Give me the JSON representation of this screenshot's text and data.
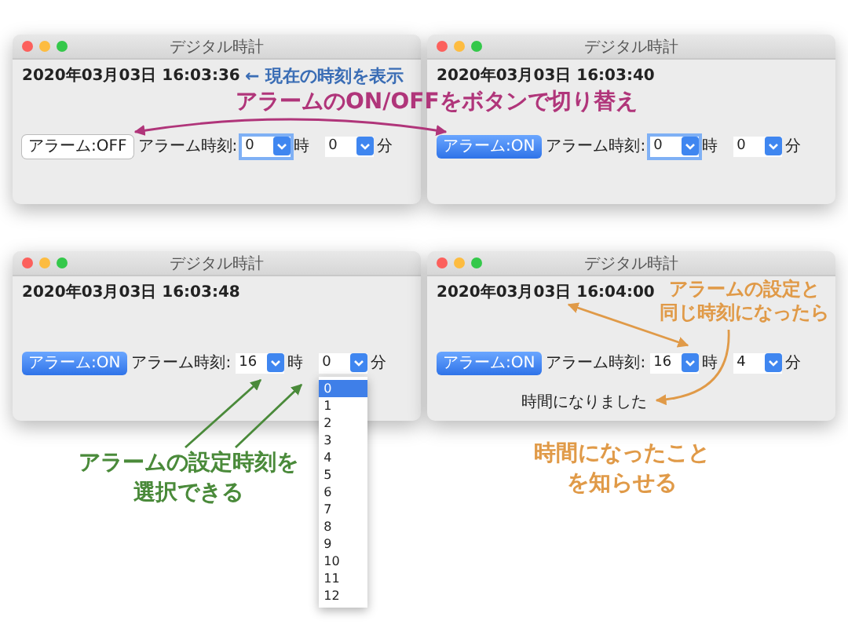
{
  "windows": [
    {
      "title": "デジタル時計",
      "datetime": "2020年03月03日 16:03:36",
      "alarm_button": {
        "label": "アラーム:OFF",
        "on": false
      },
      "time_label": "アラーム時刻:",
      "hour": {
        "value": "0",
        "focused": true
      },
      "hour_unit": "時",
      "minute": {
        "value": "0",
        "focused": false
      },
      "minute_unit": "分"
    },
    {
      "title": "デジタル時計",
      "datetime": "2020年03月03日 16:03:40",
      "alarm_button": {
        "label": "アラーム:ON",
        "on": true
      },
      "time_label": "アラーム時刻:",
      "hour": {
        "value": "0",
        "focused": true
      },
      "hour_unit": "時",
      "minute": {
        "value": "0",
        "focused": false
      },
      "minute_unit": "分"
    },
    {
      "title": "デジタル時計",
      "datetime": "2020年03月03日 16:03:48",
      "alarm_button": {
        "label": "アラーム:ON",
        "on": true
      },
      "time_label": "アラーム時刻:",
      "hour": {
        "value": "16",
        "focused": false
      },
      "hour_unit": "時",
      "minute": {
        "value": "0",
        "focused": false,
        "options": [
          {
            "label": "0",
            "selected": true
          },
          {
            "label": "1",
            "selected": false
          },
          {
            "label": "2",
            "selected": false
          },
          {
            "label": "3",
            "selected": false
          },
          {
            "label": "4",
            "selected": false
          },
          {
            "label": "5",
            "selected": false
          },
          {
            "label": "6",
            "selected": false
          },
          {
            "label": "7",
            "selected": false
          },
          {
            "label": "8",
            "selected": false
          },
          {
            "label": "9",
            "selected": false
          },
          {
            "label": "10",
            "selected": false
          },
          {
            "label": "11",
            "selected": false
          },
          {
            "label": "12",
            "selected": false
          }
        ]
      },
      "minute_unit": "分"
    },
    {
      "title": "デジタル時計",
      "datetime": "2020年03月03日 16:04:00",
      "alarm_button": {
        "label": "アラーム:ON",
        "on": true
      },
      "time_label": "アラーム時刻:",
      "hour": {
        "value": "16",
        "focused": false
      },
      "hour_unit": "時",
      "minute": {
        "value": "4",
        "focused": false
      },
      "minute_unit": "分",
      "message": "時間になりました"
    }
  ],
  "annotations": [
    {
      "lines": [
        "← 現在の時刻を表示"
      ],
      "color": "#3a6db5"
    },
    {
      "lines": [
        "アラームのON/OFFをボタンで切り替え"
      ],
      "color": "#b0357a"
    },
    {
      "lines": [
        "アラームの設定時刻を",
        "選択できる"
      ],
      "color": "#4a8a3a"
    },
    {
      "lines": [
        "アラームの設定と",
        "同じ時刻になったら"
      ],
      "color": "#e09a48"
    },
    {
      "lines": [
        "時間になったこと",
        "を知らせる"
      ],
      "color": "#e09a48"
    }
  ]
}
